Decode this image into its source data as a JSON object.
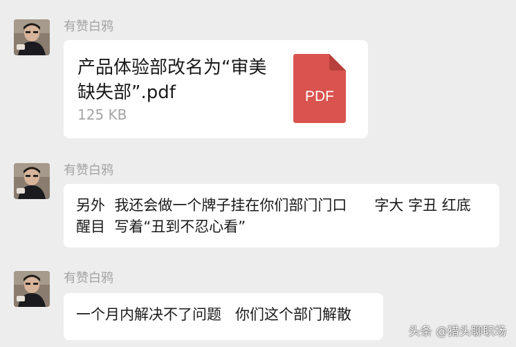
{
  "messages": [
    {
      "sender": "有赞白鸦",
      "type": "file",
      "file_name": "产品体验部改名为“审美缺失部”.pdf",
      "file_size": "125 KB",
      "file_icon": "pdf-icon",
      "file_icon_label": "PDF",
      "file_icon_color": "#d9534f"
    },
    {
      "sender": "有赞白鸦",
      "type": "text",
      "text": "另外  我还会做一个牌子挂在你们部门门口      字大 字丑 红底 醒目  写着“丑到不忍心看”"
    },
    {
      "sender": "有赞白鸦",
      "type": "text",
      "text": "一个月内解决不了问题   你们这个部门解散"
    }
  ],
  "watermark": "头条 @猎头聊职场",
  "colors": {
    "background": "#ededed",
    "bubble": "#ffffff",
    "sender_name": "#a3a3a3",
    "pdf_red": "#d9534f"
  }
}
